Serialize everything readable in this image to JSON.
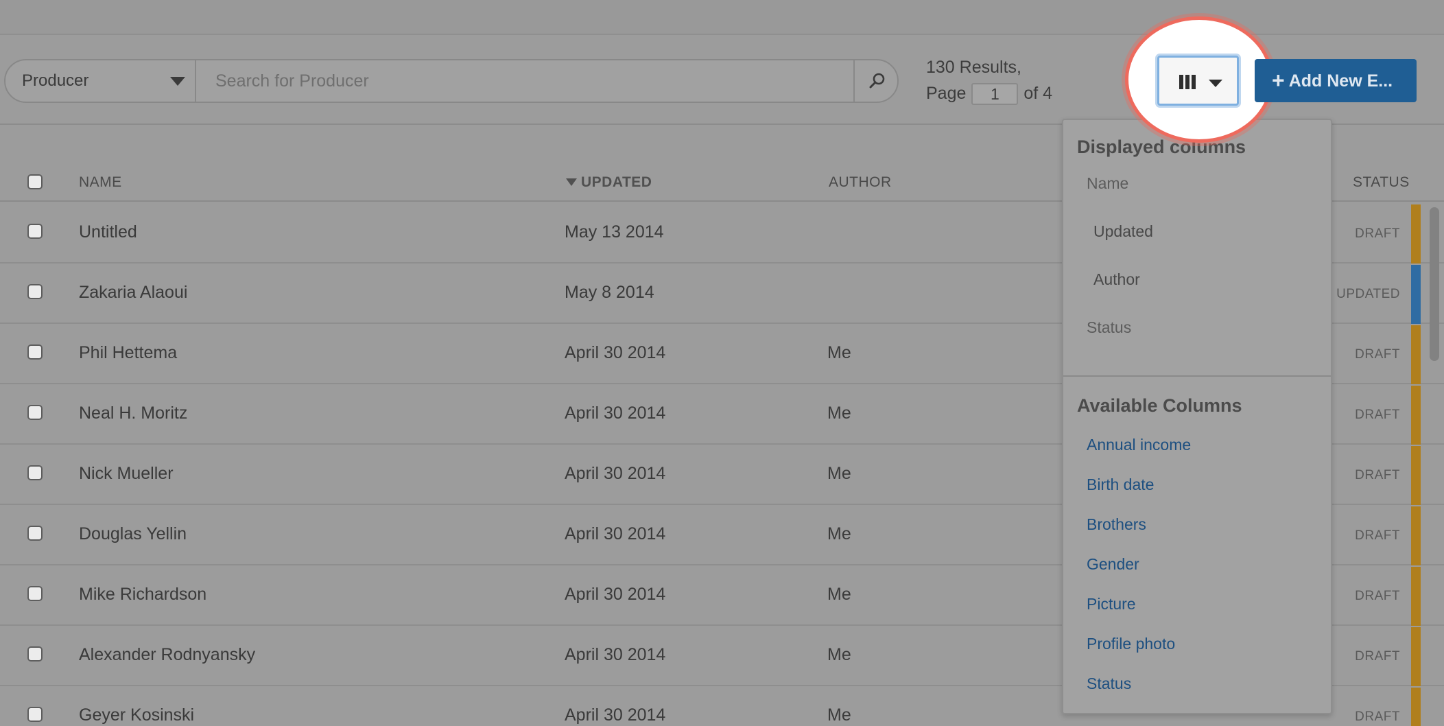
{
  "toolbar": {
    "field_select": "Producer",
    "search_placeholder": "Search for Producer",
    "results_text": "130 Results,",
    "page_label": "Page",
    "page_current": "1",
    "page_of": "of 4",
    "add_button_label": "Add New E..."
  },
  "table": {
    "headers": {
      "name": "NAME",
      "updated": "UPDATED",
      "author": "AUTHOR",
      "status": "STATUS"
    },
    "rows": [
      {
        "name": "Untitled",
        "updated": "May 13 2014",
        "author": "",
        "status": "DRAFT"
      },
      {
        "name": "Zakaria Alaoui",
        "updated": "May 8 2014",
        "author": "",
        "status": "UPDATED"
      },
      {
        "name": "Phil Hettema",
        "updated": "April 30 2014",
        "author": "Me",
        "status": "DRAFT"
      },
      {
        "name": "Neal H. Moritz",
        "updated": "April 30 2014",
        "author": "Me",
        "status": "DRAFT"
      },
      {
        "name": "Nick Mueller",
        "updated": "April 30 2014",
        "author": "Me",
        "status": "DRAFT"
      },
      {
        "name": "Douglas Yellin",
        "updated": "April 30 2014",
        "author": "Me",
        "status": "DRAFT"
      },
      {
        "name": "Mike Richardson",
        "updated": "April 30 2014",
        "author": "Me",
        "status": "DRAFT"
      },
      {
        "name": "Alexander Rodnyansky",
        "updated": "April 30 2014",
        "author": "Me",
        "status": "DRAFT"
      },
      {
        "name": "Geyer Kosinski",
        "updated": "April 30 2014",
        "author": "Me",
        "status": "DRAFT"
      }
    ]
  },
  "dropdown": {
    "displayed_title": "Displayed columns",
    "displayed": [
      "Name",
      "Updated",
      "Author",
      "Status"
    ],
    "available_title": "Available Columns",
    "available": [
      "Annual income",
      "Birth date",
      "Brothers",
      "Gender",
      "Picture",
      "Profile photo",
      "Status"
    ]
  },
  "colors": {
    "draft": "#b07f1d",
    "updated": "#2f6ca3",
    "highlight": "#ee6a5d",
    "primary": "#1f5e94"
  },
  "icons": {
    "search": "search-icon",
    "columns": "columns-icon",
    "plus": "plus-icon",
    "sort": "sort-desc-icon"
  }
}
